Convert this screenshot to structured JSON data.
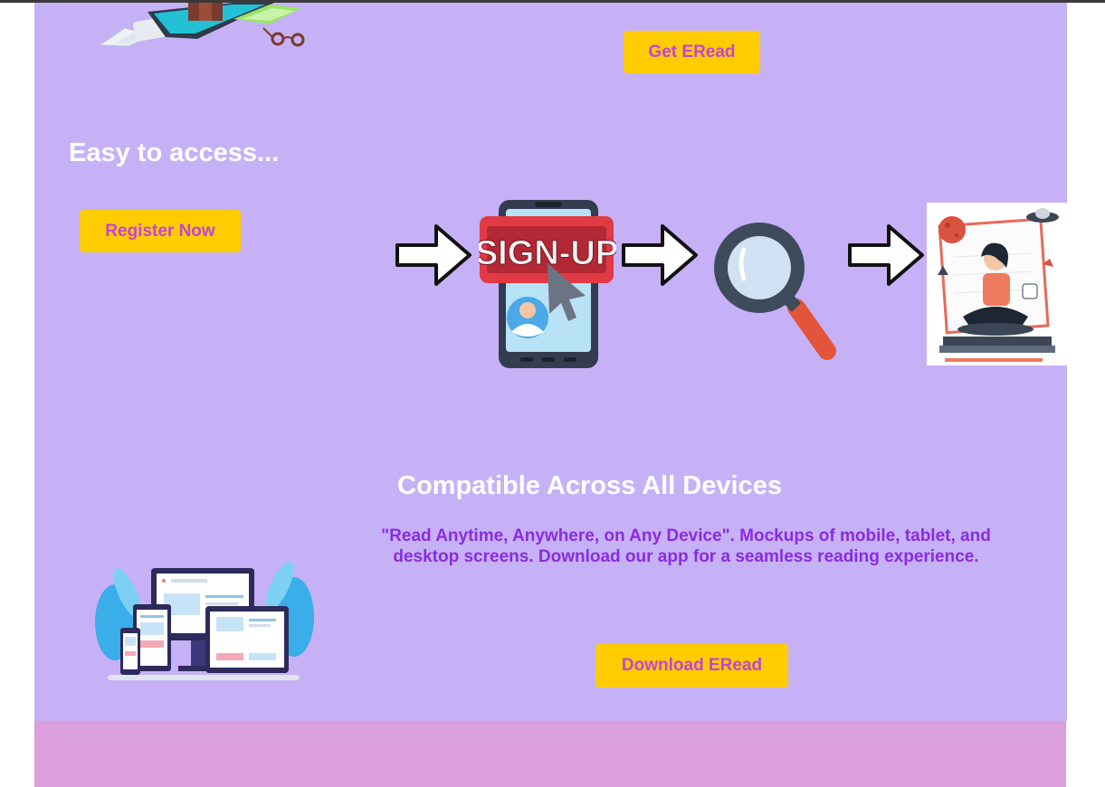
{
  "hero": {
    "get_button_label": "Get ERead"
  },
  "access": {
    "title": "Easy to access...",
    "register_button_label": "Register Now",
    "signup_badge_text": "SIGN-UP"
  },
  "devices": {
    "title": "Compatible Across All Devices",
    "description": "\"Read Anytime, Anywhere, on Any Device\". Mockups of mobile, tablet, and desktop screens. Download our app for a seamless reading experience.",
    "download_button_label": "Download ERead"
  },
  "colors": {
    "panel_background": "#c6b1f7",
    "footer_band": "#da9fdc",
    "button_background": "#ffcc00",
    "button_text": "#c542d6",
    "description_text": "#8a2be2"
  },
  "icons": [
    "books-illustration-icon",
    "arrow-right-icon",
    "signup-phone-icon",
    "magnifier-icon",
    "reading-girl-icon",
    "devices-illustration-icon"
  ]
}
